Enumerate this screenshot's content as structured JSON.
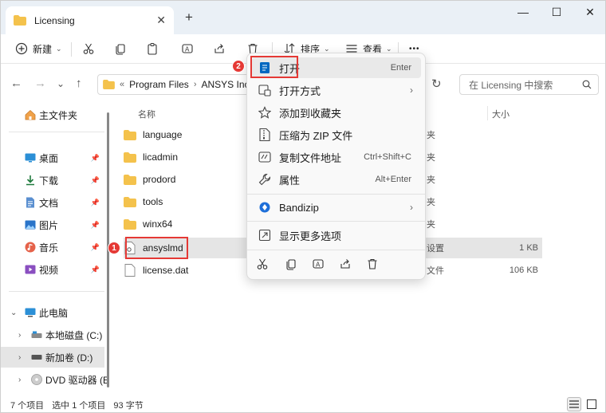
{
  "window": {
    "tab_title": "Licensing",
    "new_tab": "+",
    "controls": {
      "minimize": "—",
      "maximize": "☐",
      "close": "✕"
    }
  },
  "toolbar": {
    "new_label": "新建",
    "sort_label": "排序",
    "view_label": "查看",
    "more_label": "•••"
  },
  "address": {
    "overflow": "«",
    "crumbs": [
      "Program Files",
      "ANSYS Inc"
    ],
    "separator": "›"
  },
  "search": {
    "placeholder": "在 Licensing 中搜索"
  },
  "sidebar": {
    "home": "主文件夹",
    "quick": [
      {
        "label": "桌面",
        "icon": "desktop-icon"
      },
      {
        "label": "下载",
        "icon": "download-icon"
      },
      {
        "label": "文档",
        "icon": "document-icon"
      },
      {
        "label": "图片",
        "icon": "picture-icon"
      },
      {
        "label": "音乐",
        "icon": "music-icon"
      },
      {
        "label": "视频",
        "icon": "video-icon"
      }
    ],
    "pc": "此电脑",
    "drives": [
      "本地磁盘 (C:)",
      "新加卷 (D:)",
      "DVD 驱动器 (E:)"
    ]
  },
  "columns": {
    "name": "名称",
    "size": "大小"
  },
  "files": [
    {
      "name": "language",
      "type": "夹",
      "size": ""
    },
    {
      "name": "licadmin",
      "type": "夹",
      "size": ""
    },
    {
      "name": "prodord",
      "type": "夹",
      "size": ""
    },
    {
      "name": "tools",
      "type": "夹",
      "size": ""
    },
    {
      "name": "winx64",
      "type": "夹",
      "size": ""
    },
    {
      "name": "ansyslmd",
      "type": "设置",
      "size": "1 KB"
    },
    {
      "name": "license.dat",
      "type": "文件",
      "size": "106 KB"
    }
  ],
  "context_menu": {
    "items": [
      {
        "label": "打开",
        "shortcut": "Enter"
      },
      {
        "label": "打开方式",
        "shortcut": ""
      },
      {
        "label": "添加到收藏夹",
        "shortcut": ""
      },
      {
        "label": "压缩为 ZIP 文件",
        "shortcut": ""
      },
      {
        "label": "复制文件地址",
        "shortcut": "Ctrl+Shift+C"
      },
      {
        "label": "属性",
        "shortcut": "Alt+Enter"
      },
      {
        "label": "Bandizip",
        "shortcut": ""
      },
      {
        "label": "显示更多选项",
        "shortcut": ""
      }
    ]
  },
  "annotations": {
    "badge1": "1",
    "badge2": "2"
  },
  "status": {
    "count": "7 个项目",
    "selection": "选中 1 个项目",
    "size": "93 字节"
  },
  "colors": {
    "accent": "#0067c0",
    "highlight": "#e53935",
    "folder": "#f4c24c"
  }
}
